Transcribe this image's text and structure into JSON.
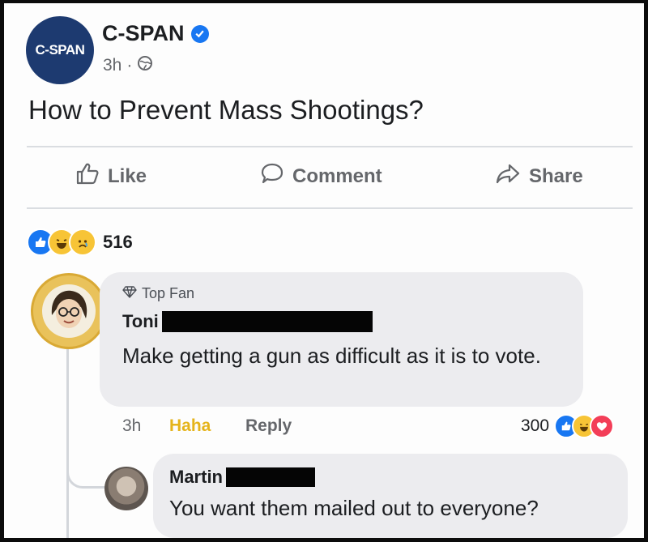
{
  "post": {
    "page_logo": "C-SPAN",
    "page_name": "C-SPAN",
    "time": "3h",
    "separator": "·",
    "audience_icon": "globe-icon",
    "verified_icon": "verified-check-icon",
    "text": "How to Prevent Mass Shootings?"
  },
  "actions": {
    "like": "Like",
    "comment": "Comment",
    "share": "Share"
  },
  "reactions": {
    "types": [
      "like",
      "haha",
      "sad"
    ],
    "count": "516"
  },
  "comments": [
    {
      "badge": "Top Fan",
      "author": "Toni",
      "text": "Make getting a gun as difficult as it is to vote.",
      "time": "3h",
      "reaction_label": "Haha",
      "reply_label": "Reply",
      "reaction_count": "300",
      "reaction_types": [
        "like",
        "haha",
        "love"
      ]
    },
    {
      "author": "Martin",
      "text": "You want them mailed out to everyone?"
    }
  ],
  "colors": {
    "brand_blue": "#1877f2",
    "cspan_navy": "#1d3a70",
    "haha_yellow": "#f7c436",
    "haha_label": "#e5b41b",
    "love_red": "#f33e58",
    "secondary_text": "#65676b",
    "bubble": "#ececef"
  }
}
